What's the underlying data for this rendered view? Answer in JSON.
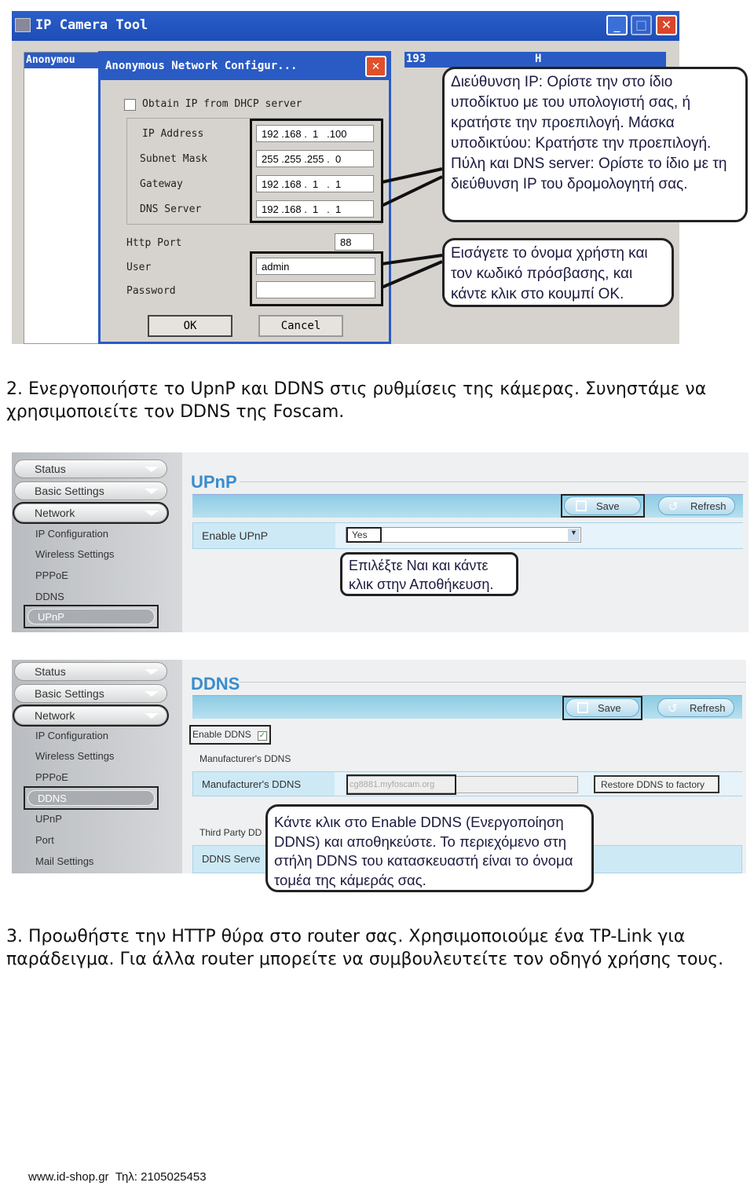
{
  "shot1": {
    "window_title": "IP Camera Tool",
    "list_header_col1": "Anonymou",
    "list_header_col2": "193",
    "list_header_col3": "H",
    "dialog_title": "Anonymous Network Configur...",
    "dhcp_label": "Obtain IP from DHCP server",
    "dhcp_checked": false,
    "fields": [
      {
        "label": "IP Address",
        "value": "192 .168 .  1   .100"
      },
      {
        "label": "Subnet Mask",
        "value": "255 .255 .255 .  0"
      },
      {
        "label": "Gateway",
        "value": "192 .168 .  1   .  1"
      },
      {
        "label": "DNS Server",
        "value": "192 .168 .  1   .  1"
      }
    ],
    "http_port_label": "Http Port",
    "http_port_value": "88",
    "user_label": "User",
    "user_value": "admin",
    "password_label": "Password",
    "password_value": "",
    "ok_label": "OK",
    "cancel_label": "Cancel",
    "callout1": "Διεύθυνση IP: Ορίστε την στο ίδιο υποδίκτυο με του υπολογιστή σας, ή κρατήστε την προεπιλογή. Μάσκα υποδικτύου: Κρατήστε την προεπιλογή. Πύλη και DNS server: Ορίστε το ίδιο με τη διεύθυνση IP του δρομολογητή σας.",
    "callout2": "Εισάγετε το όνομα χρήστη και τον κωδικό πρόσβασης, και κάντε κλικ στο κουμπί OK."
  },
  "para2": "2. Ενεργοποιήστε το UpnP και DDNS στις ρυθμίσεις της κάμερας. Συνηστάμε να χρησιμοποιείτε τον DDNS της Foscam.",
  "menu": {
    "status": "Status",
    "basic": "Basic Settings",
    "network": "Network",
    "ip_config": "IP Configuration",
    "wireless": "Wireless Settings",
    "pppoe": "PPPoE",
    "ddns": "DDNS",
    "upnp": "UPnP",
    "port": "Port",
    "mail": "Mail Settings"
  },
  "upnp_panel": {
    "title": "UPnP",
    "save": "Save",
    "refresh": "Refresh",
    "enable_label": "Enable UPnP",
    "enable_value": "Yes",
    "callout": "Επιλέξτε Ναι και κάντε κλικ στην Αποθήκευση."
  },
  "ddns_panel": {
    "title": "DDNS",
    "save": "Save",
    "refresh": "Refresh",
    "enable_label": "Enable DDNS",
    "enable_checked": true,
    "section_label": "Manufacturer's DDNS",
    "manufacturer_label": "Manufacturer's DDNS",
    "manufacturer_value": "cg8881.myfoscam.org",
    "restore_label": "Restore DDNS to factory",
    "third_party_label": "Third Party DD",
    "ddns_server_label": "DDNS Serve",
    "callout": "Κάντε κλικ στο Enable DDNS (Ενεργοποίηση DDNS) και αποθηκεύστε. Το περιεχόμενο στη στήλη DDNS του κατασκευαστή είναι το όνομα τομέα της κάμεράς σας."
  },
  "para3": "3. Προωθήστε την HTTP θύρα στο router σας. Χρησιμοποιούμε ένα TP-Link για παράδειγμα. Για άλλα router μπορείτε να συμβουλευτείτε τον οδηγό χρήσης τους.",
  "footer": "www.id-shop.gr  Τηλ: 2105025453"
}
